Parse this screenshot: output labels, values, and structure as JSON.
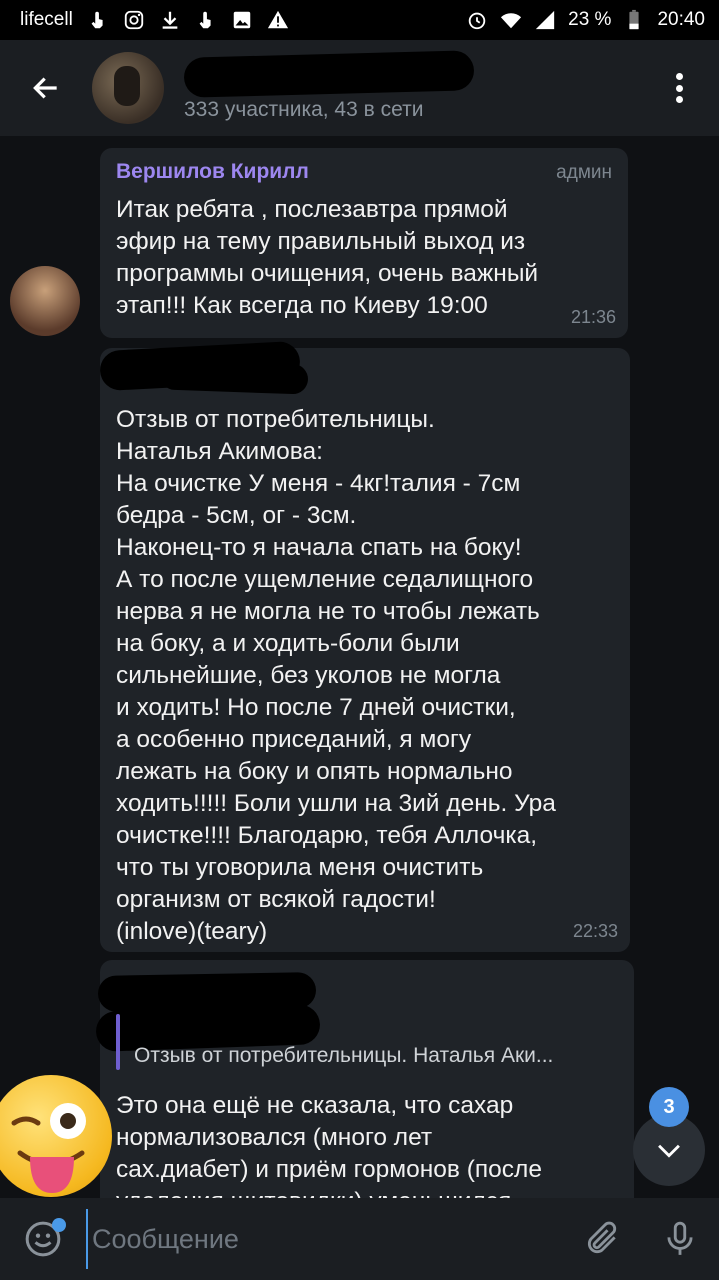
{
  "status_bar": {
    "carrier": "lifecell",
    "battery": "23 %",
    "time": "20:40"
  },
  "header": {
    "members": "333 участника, 43 в сети"
  },
  "messages": [
    {
      "sender": "Вершилов Кирилл",
      "role": "админ",
      "text": "Итак ребята , послезавтра прямой\nэфир на тему правильный выход из\nпрограммы очищения, очень важный\nэтап!!! Как всегда по Киеву 19:00",
      "time": "21:36"
    },
    {
      "text": "Отзыв от потребительницы.\nНаталья Акимова:\nНа очистке У меня - 4кг!талия - 7см\nбедра - 5см, ог - 3см.\n Наконец-то я начала спать на боку!\nА то после ущемление седалищного\nнерва я не могла не то чтобы лежать\nна боку, а и ходить-боли были\nсильнейшие, без уколов не могла\nи ходить! Но после 7 дней очистки,\nа особенно приседаний, я могу\nлежать на боку и опять нормально\nходить!!!!! Боли ушли на 3ий день. Ура\nочистке!!!! Благодарю, тебя Аллочка,\nчто ты уговорила меня очистить\nорганизм от всякой гадости!\n(inlove)(teary)",
      "time": "22:33"
    },
    {
      "reply_preview": "Отзыв от потребительницы. Наталья Аки...",
      "text": "Это она ещё не сказала, что сахар\nнормализовался (много лет\nсах.диабет) и приём гормонов (после\nудаления щитовидки) уменьшился"
    }
  ],
  "scroll": {
    "unread_count": "3"
  },
  "input": {
    "placeholder": "Сообщение"
  }
}
